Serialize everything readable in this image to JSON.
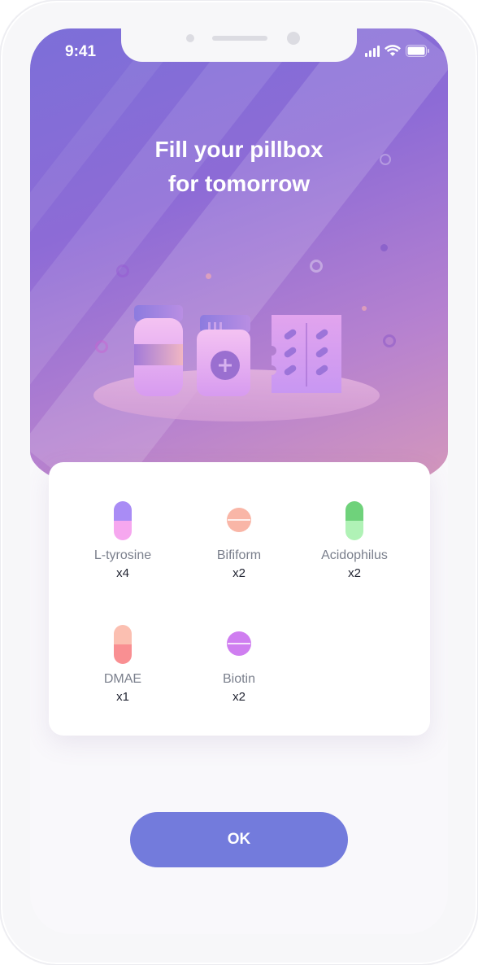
{
  "status_bar": {
    "time": "9:41"
  },
  "header": {
    "title_line1": "Fill your pillbox",
    "title_line2": "for tomorrow"
  },
  "pills": [
    {
      "name": "L-tyrosine",
      "quantity": "x4",
      "icon": "capsule-icon",
      "color_top": "#a98cf5",
      "color_bottom": "#f6a7ef"
    },
    {
      "name": "Bifiform",
      "quantity": "x2",
      "icon": "tablet-icon",
      "color": "#f9b6a7"
    },
    {
      "name": "Acidophilus",
      "quantity": "x2",
      "icon": "capsule-icon",
      "color_top": "#6fd27b",
      "color_bottom": "#b0f2b6"
    },
    {
      "name": "DMAE",
      "quantity": "x1",
      "icon": "capsule-icon",
      "color_top": "#fbbfb1",
      "color_bottom": "#f98f92"
    },
    {
      "name": "Biotin",
      "quantity": "x2",
      "icon": "tablet-icon",
      "color": "#cf7ef0"
    }
  ],
  "actions": {
    "ok_label": "OK"
  },
  "colors": {
    "accent": "#737bdc",
    "hero_start": "#7c6fd8",
    "hero_end": "#d99bb8"
  }
}
